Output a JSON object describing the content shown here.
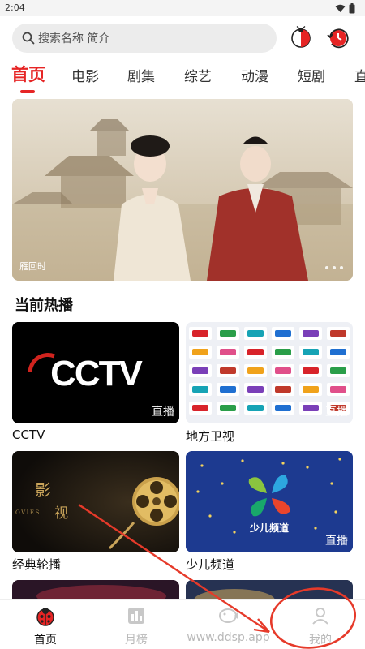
{
  "status": {
    "time": "2:04"
  },
  "search": {
    "placeholder": "搜索名称 简介"
  },
  "tabs": [
    {
      "label": "首页"
    },
    {
      "label": "电影"
    },
    {
      "label": "剧集"
    },
    {
      "label": "综艺"
    },
    {
      "label": "动漫"
    },
    {
      "label": "短剧"
    },
    {
      "label": "直"
    }
  ],
  "banner": {
    "caption": "雁回时"
  },
  "section": {
    "title": "当前热播"
  },
  "cards": [
    {
      "label": "CCTV",
      "badge": "直播",
      "logo_text": "CCTV"
    },
    {
      "label": "地方卫视",
      "badge": "直播"
    },
    {
      "label": "经典轮播",
      "badge": "",
      "text_top": "影",
      "text_bottom": "视",
      "side_text": "OVIES"
    },
    {
      "label": "少儿频道",
      "badge": "直播",
      "logo_text": "少儿频道"
    }
  ],
  "bottom_nav": [
    {
      "label": "首页",
      "icon": "ladybug-home-icon",
      "active": true
    },
    {
      "label": "月榜",
      "icon": "chart-icon",
      "active": false
    },
    {
      "label": "www.ddsp.app",
      "icon": "fish-icon",
      "active": false
    },
    {
      "label": "我的",
      "icon": "user-icon",
      "active": false
    }
  ],
  "colors": {
    "accent": "#e62525",
    "annotation": "#e63a2a",
    "search_bg": "#ececec"
  }
}
